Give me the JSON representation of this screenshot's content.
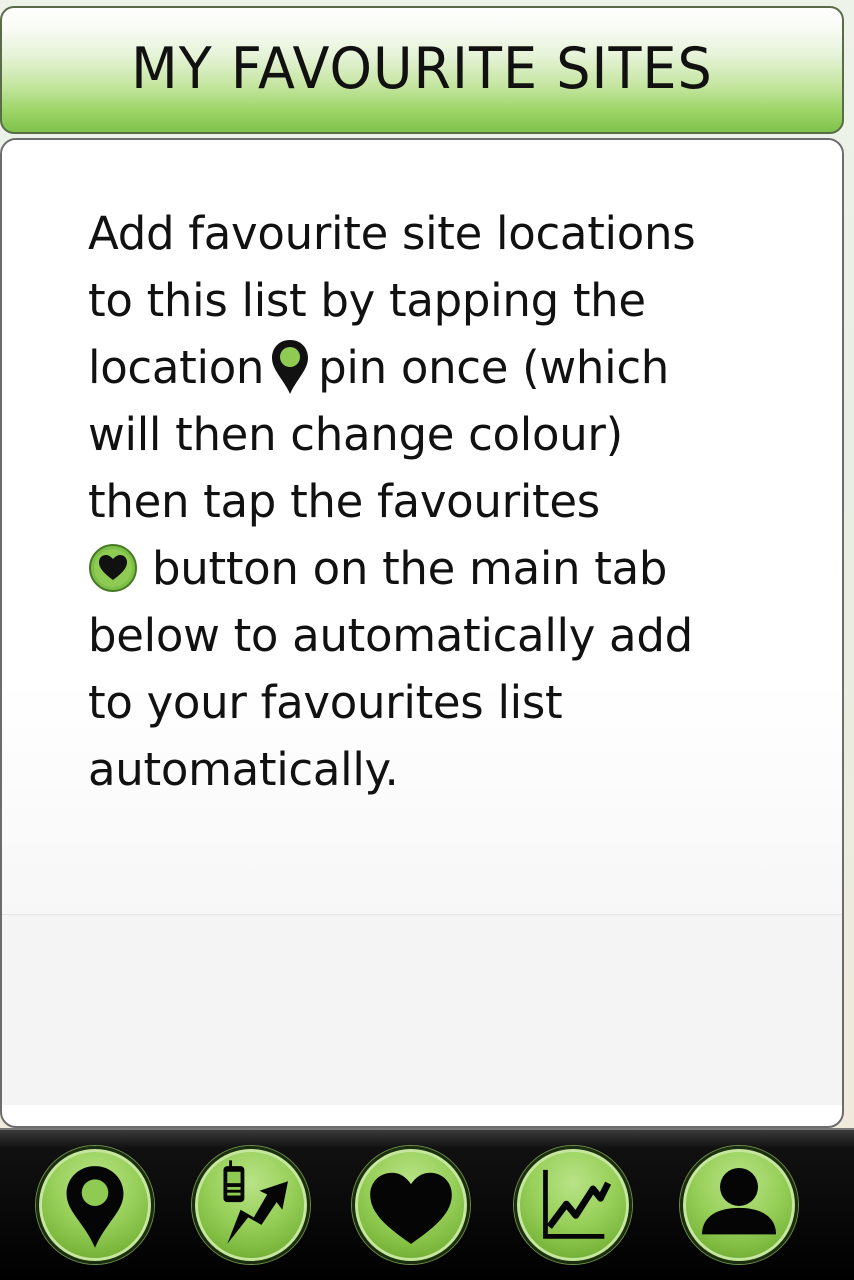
{
  "header": {
    "title": "MY FAVOURITE SITES"
  },
  "instructions": {
    "line1": "Add favourite site locations",
    "line2": "to this list by tapping the",
    "line3_before": "location",
    "line3_after": "pin once (which",
    "line4": "will  then change colour)",
    "line5": "then tap the favourites",
    "line6_after": "button on the main tab",
    "line7": "below to automatically add",
    "line8": "to your favourites list",
    "line9": "automatically."
  },
  "icons": {
    "inline_pin": "location-pin-icon",
    "inline_heart": "heart-favourite-icon"
  },
  "tabbar": {
    "tabs": [
      {
        "icon": "location-pin-icon"
      },
      {
        "icon": "phone-direction-icon"
      },
      {
        "icon": "heart-icon"
      },
      {
        "icon": "chart-trend-icon"
      },
      {
        "icon": "user-profile-icon"
      }
    ]
  },
  "colors": {
    "accent_green": "#8fcb52",
    "dark_green": "#5c9628",
    "tabbar_bg": "#000000"
  }
}
